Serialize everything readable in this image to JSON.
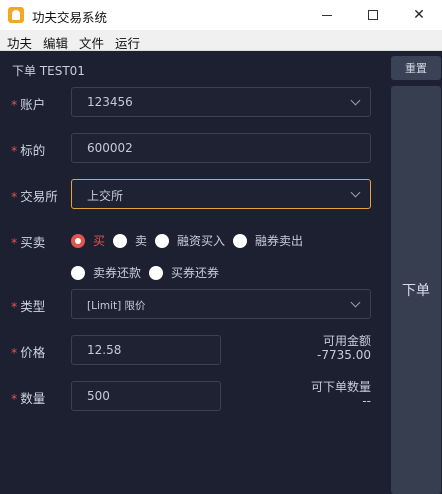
{
  "window": {
    "title": "功夫交易系统",
    "minimize": "",
    "close": "✕"
  },
  "menu": [
    "功夫",
    "编辑",
    "文件",
    "运行"
  ],
  "panel": {
    "title": "下单 TEST01"
  },
  "side": {
    "reset_label": "重置",
    "submit_label": "下单"
  },
  "form": {
    "required_mark": "*",
    "account": {
      "label": "账户",
      "value": "123456"
    },
    "instrument": {
      "label": "标的",
      "value": "600002"
    },
    "exchange": {
      "label": "交易所",
      "value": "上交所"
    },
    "side": {
      "label": "买卖",
      "options": [
        "买",
        "卖",
        "融资买入",
        "融券卖出",
        "卖券还款",
        "买券还券"
      ],
      "selected": "买"
    },
    "order_type": {
      "label": "类型",
      "value": "[Limit] 限价"
    },
    "price": {
      "label": "价格",
      "value": "12.58"
    },
    "quantity": {
      "label": "数量",
      "value": "500"
    },
    "available_funds": {
      "label": "可用金额",
      "value": "-7735.00"
    },
    "max_quantity": {
      "label": "可下单数量",
      "value": "--"
    }
  },
  "colors": {
    "accent": "#e5a33a",
    "danger": "#e0554f",
    "background": "#1c2030"
  }
}
